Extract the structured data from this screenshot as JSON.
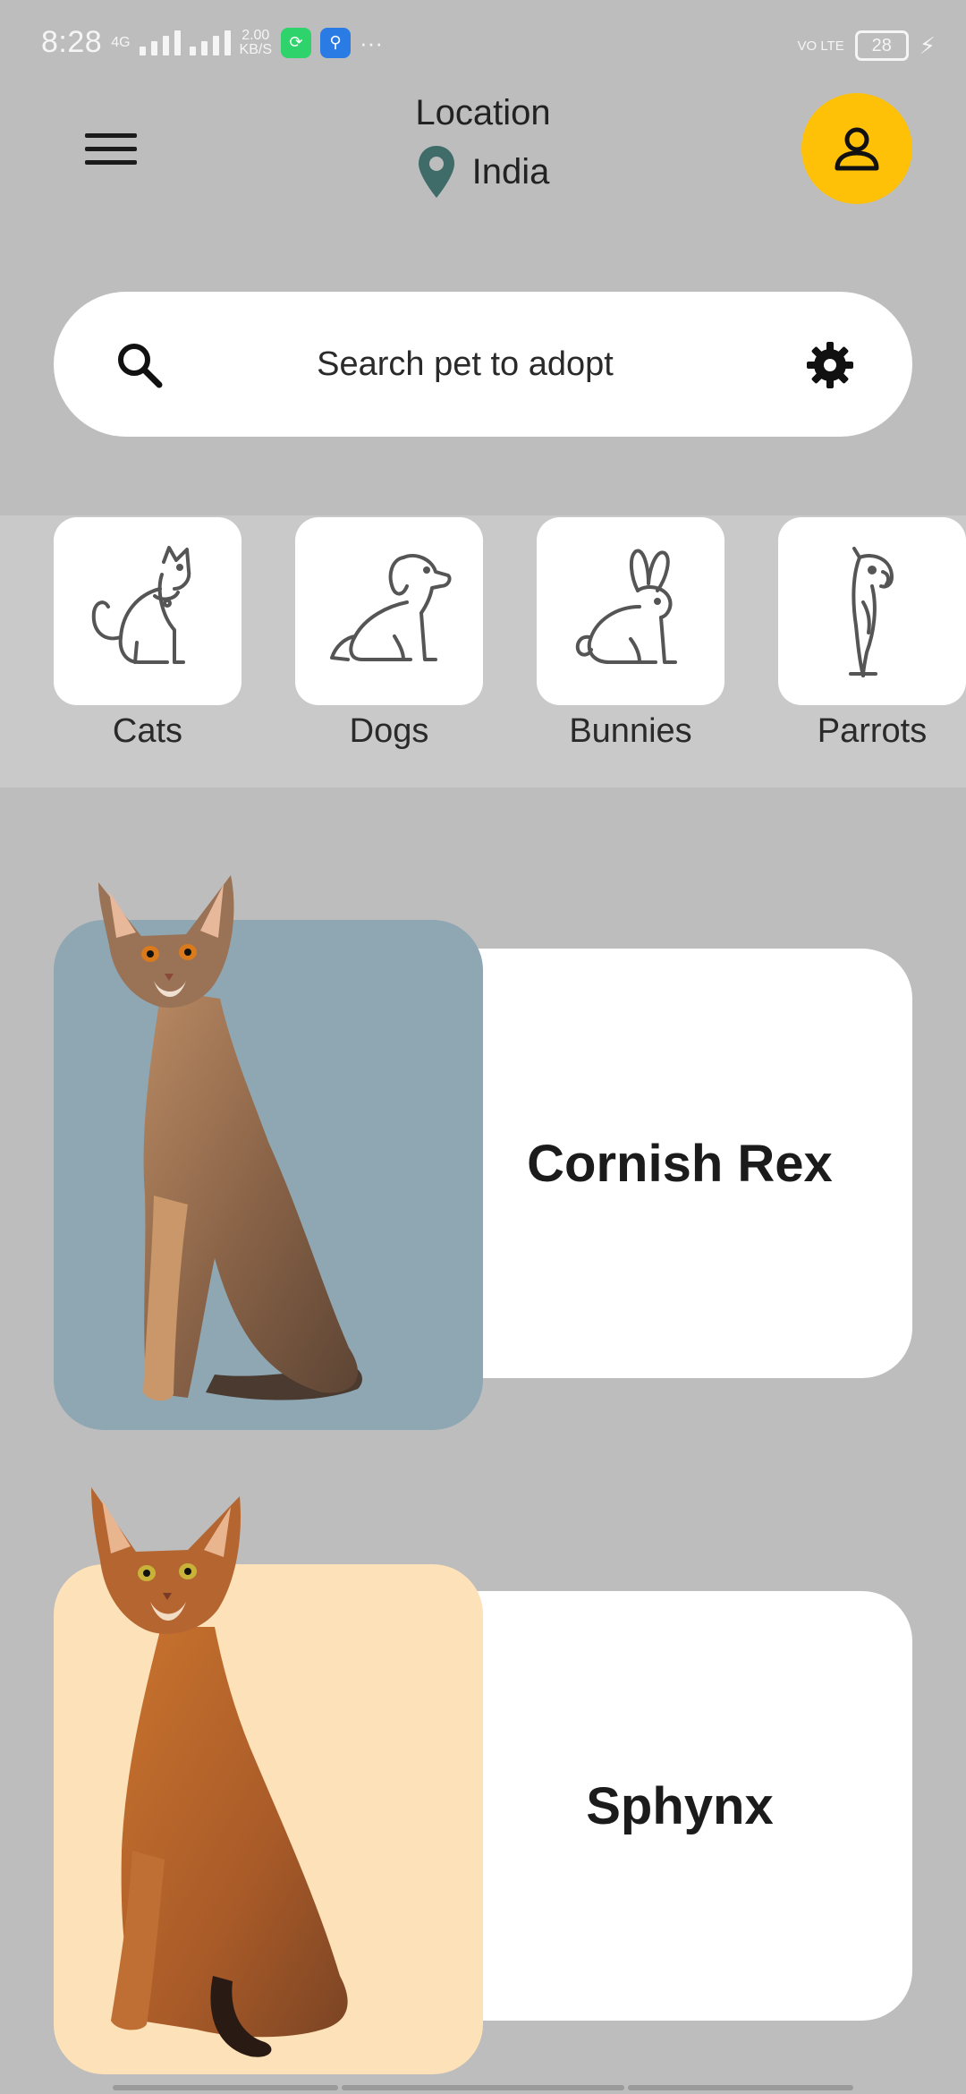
{
  "status_bar": {
    "time": "8:28",
    "network_left": "4G",
    "speed_value": "2.00",
    "speed_unit": "KB/S",
    "dots": "···",
    "volte": "VO LTE",
    "battery": "28"
  },
  "header": {
    "location_label": "Location",
    "location_value": "India"
  },
  "search": {
    "placeholder": "Search pet to adopt"
  },
  "categories": [
    {
      "label": "Cats",
      "icon": "cat-icon"
    },
    {
      "label": "Dogs",
      "icon": "dog-icon"
    },
    {
      "label": "Bunnies",
      "icon": "bunny-icon"
    },
    {
      "label": "Parrots",
      "icon": "parrot-icon"
    }
  ],
  "pets": [
    {
      "name": "Cornish Rex",
      "photo_bg": "#8fa7b3",
      "photo": "cat-photo"
    },
    {
      "name": "Sphynx",
      "photo_bg": "#fde1b8",
      "photo": "cat-photo"
    }
  ],
  "colors": {
    "background": "#bdbdbd",
    "accent": "#ffc107",
    "pin": "#3f6b69"
  }
}
